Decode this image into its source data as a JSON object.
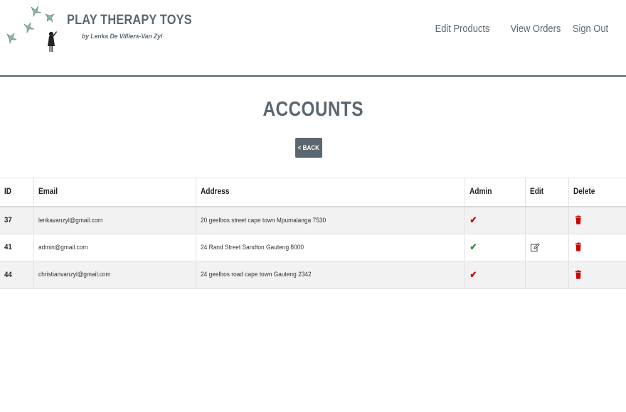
{
  "brand": {
    "title": "PLAY THERAPY TOYS",
    "subtitle": "by Lenka De Villiers-Van Zyl"
  },
  "nav": {
    "items": [
      {
        "label": "Edit Products"
      },
      {
        "label": "View Orders"
      },
      {
        "label": "Sign Out"
      }
    ]
  },
  "page": {
    "title": "ACCOUNTS",
    "back_label": "< BACK"
  },
  "table": {
    "headers": {
      "id": "ID",
      "email": "Email",
      "address": "Address",
      "admin": "Admin",
      "edit": "Edit",
      "delete": "Delete"
    },
    "rows": [
      {
        "id": "37",
        "email": "lenkavanzyl@gmail.com",
        "address": "20 geelbos street cape town Mpumalanga 7530",
        "admin_icon": "check-icon",
        "admin_color": "#cc0000",
        "editable": false
      },
      {
        "id": "41",
        "email": "admin@gmail.com",
        "address": "24 Rand Street Sandton Gauteng 8000",
        "admin_icon": "check-icon",
        "admin_color": "#2e8b2e",
        "editable": true
      },
      {
        "id": "44",
        "email": "christianvanzyl@gmail.com",
        "address": "24 geelbos road cape town Gauteng 2342",
        "admin_icon": "check-icon",
        "admin_color": "#cc0000",
        "editable": false
      }
    ]
  },
  "colors": {
    "primary": "#5b6770",
    "delete": "#cc0000",
    "admin_yes": "#2e8b2e",
    "admin_no": "#cc0000",
    "row_alt": "#f2f2f2"
  }
}
